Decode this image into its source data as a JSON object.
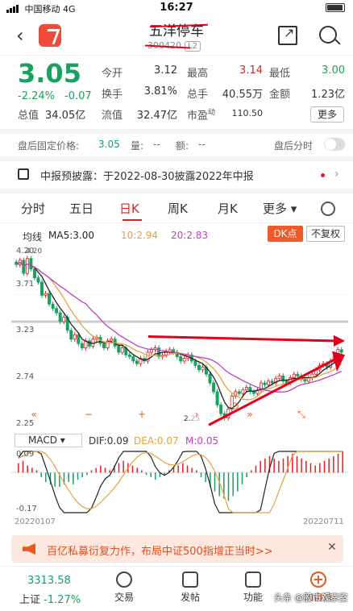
{
  "status": {
    "carrier": "中国移动",
    "network": "4G",
    "time": "16:27"
  },
  "header": {
    "title": "五洋停车",
    "code": "300420",
    "tag": "L2"
  },
  "quote": {
    "price": "3.05",
    "change_pct": "-2.24%",
    "change": "-0.07",
    "open_label": "今开",
    "open": "3.12",
    "high_label": "最高",
    "high": "3.14",
    "low_label": "最低",
    "low": "3.00",
    "turnover_label": "换手",
    "turnover": "3.81%",
    "volume_label": "总手",
    "volume": "40.55万",
    "amount_label": "金额",
    "amount": "1.23亿",
    "mcap_label": "总值",
    "mcap": "34.05亿",
    "float_label": "流值",
    "float_mcap": "32.47亿",
    "pe_label": "市盈",
    "pe_sup": "动",
    "pe": "110.50",
    "more_label": "更多"
  },
  "afterhours": {
    "price_label": "盘后固定价格:",
    "price": "3.05",
    "volume_label": "量:",
    "volume": "--",
    "amount_label": "额:",
    "amount": "--",
    "tick_label": "盘后分时"
  },
  "notice": {
    "text": "中报预披露：于2022-08-30披露2022年中报"
  },
  "tabs": [
    {
      "label": "分时"
    },
    {
      "label": "五日"
    },
    {
      "label": "日K",
      "active": true
    },
    {
      "label": "周K"
    },
    {
      "label": "月K"
    },
    {
      "label": "更多"
    }
  ],
  "ma": {
    "title": "均线",
    "ma5": "MA5:3.00",
    "ma10": "10:2.94",
    "ma20": "20:2.83",
    "dk_label": "DK点",
    "adjust_label": "不复权"
  },
  "chart_data": [
    {
      "type": "candlestick",
      "title": "",
      "yticks": [
        "4.20",
        "3.71",
        "3.23",
        "2.74",
        "2.25"
      ],
      "ylim": [
        2.25,
        4.2
      ],
      "annotations": [
        "4.20",
        "2.25",
        "D"
      ],
      "x_start": "20220107",
      "x_end": "20220711",
      "close": [
        4.05,
        4.1,
        3.95,
        4.12,
        4.0,
        3.9,
        3.85,
        3.7,
        3.72,
        3.6,
        3.55,
        3.5,
        3.4,
        3.45,
        3.3,
        3.2,
        3.25,
        3.15,
        3.1,
        3.18,
        3.12,
        3.2,
        3.22,
        3.15,
        3.1,
        3.18,
        3.2,
        3.12,
        3.05,
        3.1,
        3.02,
        3.0,
        2.95,
        2.92,
        2.98,
        2.95,
        3.05,
        3.08,
        3.1,
        3.0,
        3.02,
        3.06,
        3.08,
        3.05,
        3.0,
        2.95,
        2.98,
        3.02,
        2.95,
        2.9,
        2.85,
        2.88,
        2.8,
        2.7,
        2.6,
        2.45,
        2.35,
        2.3,
        2.4,
        2.55,
        2.6,
        2.58,
        2.62,
        2.65,
        2.6,
        2.58,
        2.62,
        2.7,
        2.68,
        2.72,
        2.7,
        2.75,
        2.78,
        2.72,
        2.7,
        2.76,
        2.8,
        2.78,
        2.74,
        2.72,
        2.76,
        2.8,
        2.85,
        2.9,
        2.92,
        2.88,
        2.95,
        3.0,
        3.08,
        3.05
      ],
      "ma5": "3.00",
      "ma10": "2.94",
      "ma20": "2.83"
    },
    {
      "type": "bar",
      "title": "MACD",
      "ylim": [
        -0.17,
        0.09
      ],
      "yticks": [
        "0.09",
        "-0.17"
      ],
      "dif": "0.09",
      "dea": "0.07",
      "m": "0.05",
      "histogram": [
        0.04,
        0.05,
        0.03,
        0.02,
        0.01,
        -0.02,
        -0.04,
        -0.05,
        -0.06,
        -0.06,
        -0.05,
        -0.04,
        -0.05,
        -0.03,
        -0.02,
        -0.01,
        0.01,
        0.02,
        0.03,
        0.02,
        0.01,
        0.03,
        0.04,
        0.05,
        0.04,
        0.03,
        0.02,
        0.01,
        -0.01,
        -0.02,
        -0.03,
        -0.02,
        -0.01,
        0.01,
        0.02,
        0.03,
        0.04,
        0.03,
        0.02,
        0.01,
        -0.02,
        -0.04,
        -0.06,
        -0.08,
        -0.1,
        -0.11,
        -0.12,
        -0.1,
        -0.08,
        -0.05,
        -0.02,
        0.01,
        0.03,
        0.05,
        0.06,
        0.07,
        0.06,
        0.05,
        0.06,
        0.07,
        0.08,
        0.07,
        0.06,
        0.05,
        0.04,
        0.03,
        0.04,
        0.05,
        0.06,
        0.07,
        0.08,
        0.09
      ]
    }
  ],
  "macd_head": {
    "selector": "MACD",
    "dif": "DIF:0.09",
    "dea": "DEA:0.07",
    "m": "M:0.05"
  },
  "dates": {
    "start": "20220107",
    "end": "20220711"
  },
  "ad": {
    "text": "百亿私募衍复力作，布局中证500指增正当时>>"
  },
  "bottom": {
    "index_value": "3313.58",
    "index_name": "上证",
    "index_change": "-1.27%",
    "items": [
      {
        "label": "交易"
      },
      {
        "label": "发帖"
      },
      {
        "label": "功能"
      },
      {
        "label": "加自选"
      }
    ]
  },
  "watermark": "头条 @股市观察室",
  "colors": {
    "up": "#e02020",
    "down": "#19a15f",
    "accent": "#ef5a2a",
    "ma5": "#222222",
    "ma10": "#e6a23c",
    "ma20": "#c040c0"
  }
}
